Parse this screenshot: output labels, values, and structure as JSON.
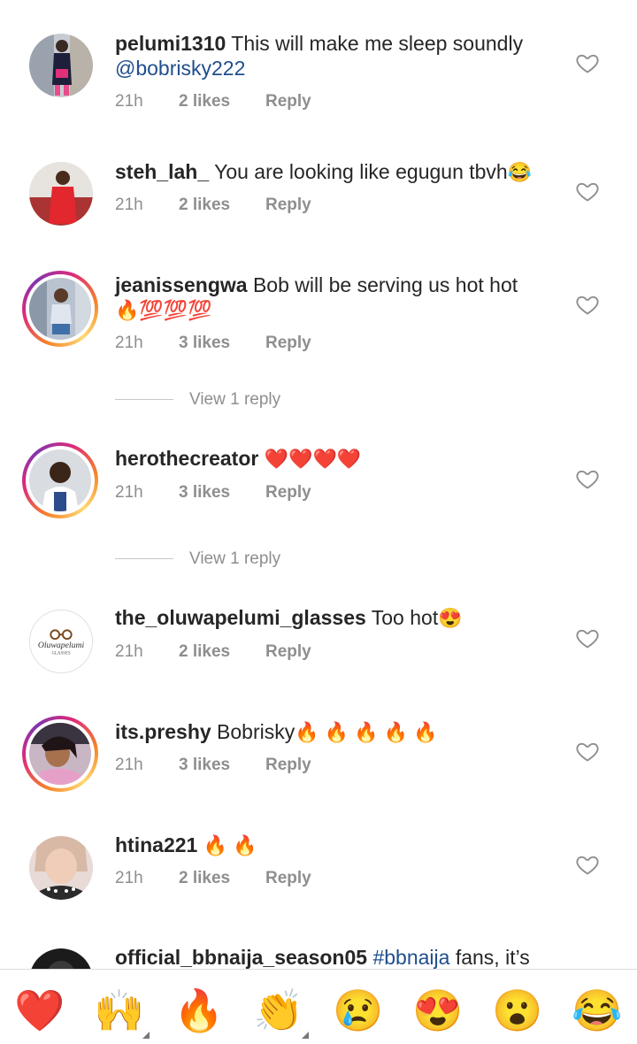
{
  "comments": [
    {
      "username": "pelumi1310",
      "text": "This will make me sleep soundly",
      "mention": "@bobrisky222",
      "time": "21h",
      "likes": "2 likes",
      "reply": "Reply"
    },
    {
      "username": "steh_lah_",
      "text": "You are looking like egugun tbvh",
      "emoji": "😂",
      "time": "21h",
      "likes": "2 likes",
      "reply": "Reply"
    },
    {
      "username": "jeanissengwa",
      "text": "Bob will be serving us hot hot",
      "emoji": "🔥💯💯💯",
      "time": "21h",
      "likes": "3 likes",
      "reply": "Reply",
      "view_replies": "View 1 reply"
    },
    {
      "username": "herothecreator",
      "emoji": "❤️❤️❤️❤️",
      "time": "21h",
      "likes": "3 likes",
      "reply": "Reply",
      "view_replies": "View 1 reply"
    },
    {
      "username": "the_oluwapelumi_glasses",
      "text": "Too hot",
      "emoji": "😍",
      "time": "21h",
      "likes": "2 likes",
      "reply": "Reply",
      "avatar_logo": "Oluwapelumi",
      "avatar_logo_sub": "GLASSES"
    },
    {
      "username": "its.preshy",
      "text": "Bobrisky",
      "emoji": "🔥 🔥 🔥 🔥 🔥",
      "time": "21h",
      "likes": "3 likes",
      "reply": "Reply"
    },
    {
      "username": "htina221",
      "emoji": "🔥 🔥",
      "time": "21h",
      "likes": "2 likes",
      "reply": "Reply"
    },
    {
      "username": "official_bbnaija_season05",
      "hashtag": "#bbnaija",
      "text": "fans, it’s"
    }
  ],
  "emoji_bar": [
    {
      "name": "red-heart",
      "char": "❤️"
    },
    {
      "name": "raising-hands",
      "char": "🙌"
    },
    {
      "name": "fire",
      "char": "🔥"
    },
    {
      "name": "clapping-hands",
      "char": "👏"
    },
    {
      "name": "crying-face",
      "char": "😢"
    },
    {
      "name": "heart-eyes",
      "char": "😍"
    },
    {
      "name": "astonished-face",
      "char": "😮"
    },
    {
      "name": "tears-of-joy",
      "char": "😂"
    }
  ],
  "colors": {
    "mention": "#1f4e8c",
    "meta": "#8e8e8e",
    "story_ring": "#dd2a7b"
  }
}
